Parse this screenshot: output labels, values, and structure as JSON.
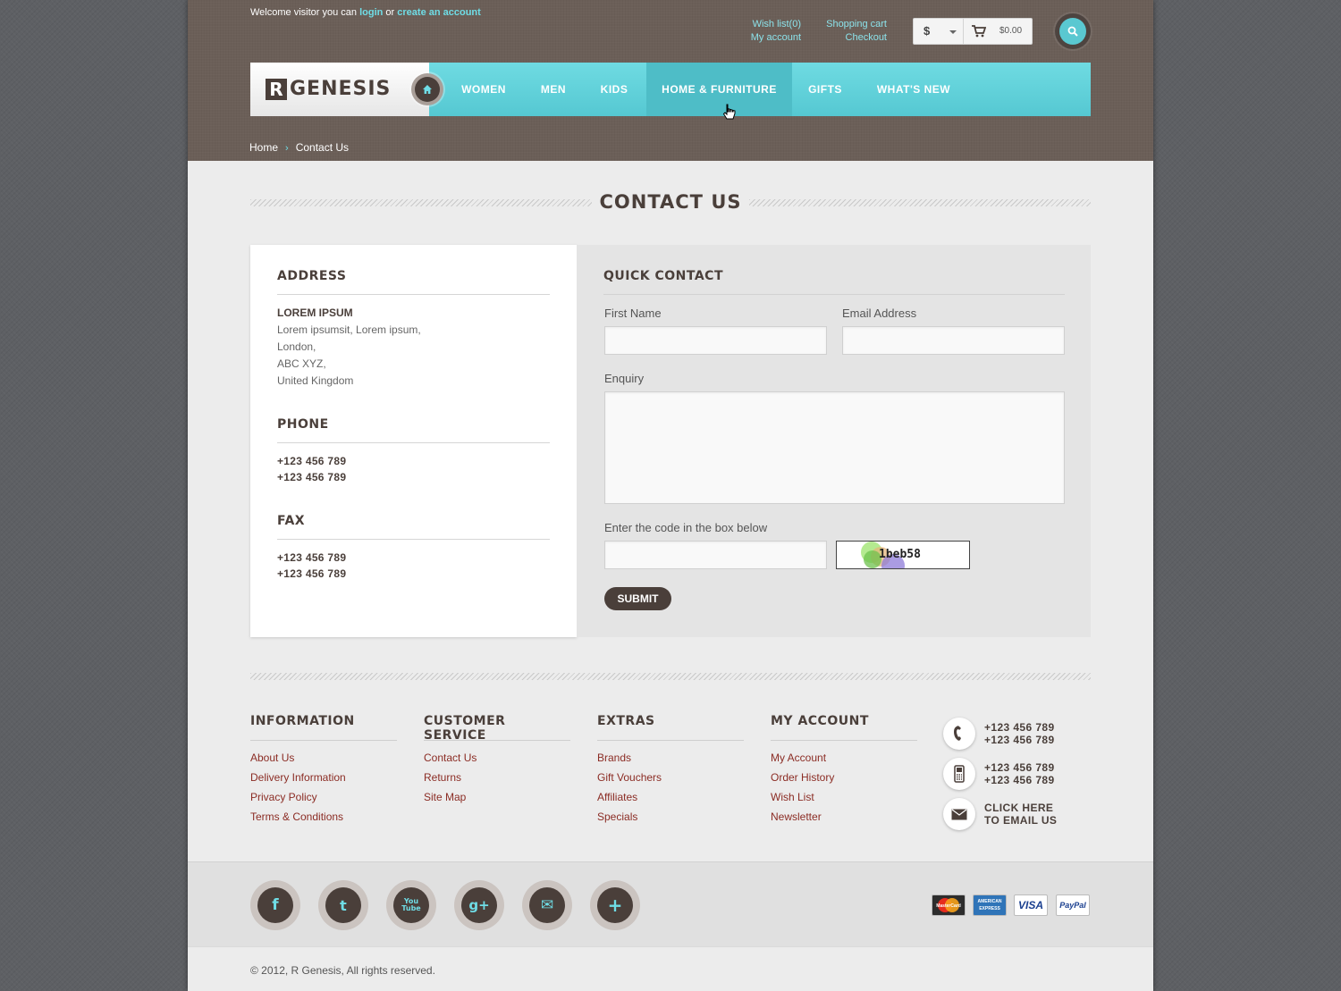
{
  "header": {
    "welcome_prefix": "Welcome visitor you can",
    "login_label": "login",
    "or_text": "or",
    "create_account_label": "create an account",
    "wishlist_label": "Wish list(0)",
    "my_account_label": "My account",
    "shopping_cart_label": "Shopping cart",
    "checkout_label": "Checkout",
    "currency": "$",
    "cart_total": "$0.00",
    "search_icon": "search-icon"
  },
  "logo": {
    "mark": "R",
    "text": "GENESIS"
  },
  "nav": {
    "items": [
      {
        "label": "WOMEN"
      },
      {
        "label": "MEN"
      },
      {
        "label": "KIDS"
      },
      {
        "label": "HOME & FURNITURE",
        "active": true
      },
      {
        "label": "GIFTS"
      },
      {
        "label": "WHAT'S NEW"
      }
    ]
  },
  "breadcrumb": {
    "home": "Home",
    "separator": "›",
    "current": "Contact Us"
  },
  "page_title": "CONTACT US",
  "address": {
    "heading": "ADDRESS",
    "name": "LOREM IPSUM",
    "lines": [
      "Lorem ipsumsit, Lorem ipsum,",
      "London,",
      "ABC XYZ,",
      "United Kingdom"
    ],
    "phone_heading": "PHONE",
    "phones": [
      "+123 456 789",
      "+123 456 789"
    ],
    "fax_heading": "FAX",
    "faxes": [
      "+123 456 789",
      "+123 456 789"
    ]
  },
  "quick_contact": {
    "heading": "QUICK CONTACT",
    "first_name_label": "First Name",
    "first_name_value": "",
    "email_label": "Email Address",
    "email_value": "",
    "enquiry_label": "Enquiry",
    "enquiry_value": "",
    "captcha_label": "Enter the code in the box below",
    "captcha_value": "",
    "captcha_code": "1beb58",
    "submit_label": "SUBMIT"
  },
  "footer": {
    "columns": [
      {
        "heading": "INFORMATION",
        "links": [
          "About Us",
          "Delivery Information",
          "Privacy Policy",
          "Terms & Conditions"
        ]
      },
      {
        "heading": "CUSTOMER SERVICE",
        "links": [
          "Contact Us",
          "Returns",
          "Site Map"
        ]
      },
      {
        "heading": "EXTRAS",
        "links": [
          "Brands",
          "Gift Vouchers",
          "Affiliates",
          "Specials"
        ]
      },
      {
        "heading": "MY ACCOUNT",
        "links": [
          "My Account",
          "Order History",
          "Wish List",
          "Newsletter"
        ]
      }
    ],
    "contact": {
      "phone_lines": [
        "+123 456 789",
        "+123 456 789"
      ],
      "mobile_lines": [
        "+123 456 789",
        "+123 456 789"
      ],
      "email_lines": [
        "CLICK HERE",
        "TO EMAIL US"
      ]
    },
    "social": [
      {
        "icon": "facebook-icon",
        "glyph": "f"
      },
      {
        "icon": "twitter-icon",
        "glyph": "t"
      },
      {
        "icon": "youtube-icon",
        "glyph": "You Tube"
      },
      {
        "icon": "google-plus-icon",
        "glyph": "g+"
      },
      {
        "icon": "email-icon",
        "glyph": "✉"
      },
      {
        "icon": "plus-icon",
        "glyph": "+"
      }
    ],
    "payments": [
      {
        "icon": "mastercard-icon",
        "label": "MasterCard"
      },
      {
        "icon": "american-express-icon",
        "label": "AMERICAN EXPRESS"
      },
      {
        "icon": "visa-icon",
        "label": "VISA"
      },
      {
        "icon": "paypal-icon",
        "label": "PayPal"
      }
    ],
    "copyright": "© 2012, R Genesis, All rights reserved."
  },
  "colors": {
    "accent": "#5ac8d1",
    "brand_dark": "#4a3f3a",
    "header_bg": "#6b5f58",
    "link_red": "#8b2c24"
  }
}
